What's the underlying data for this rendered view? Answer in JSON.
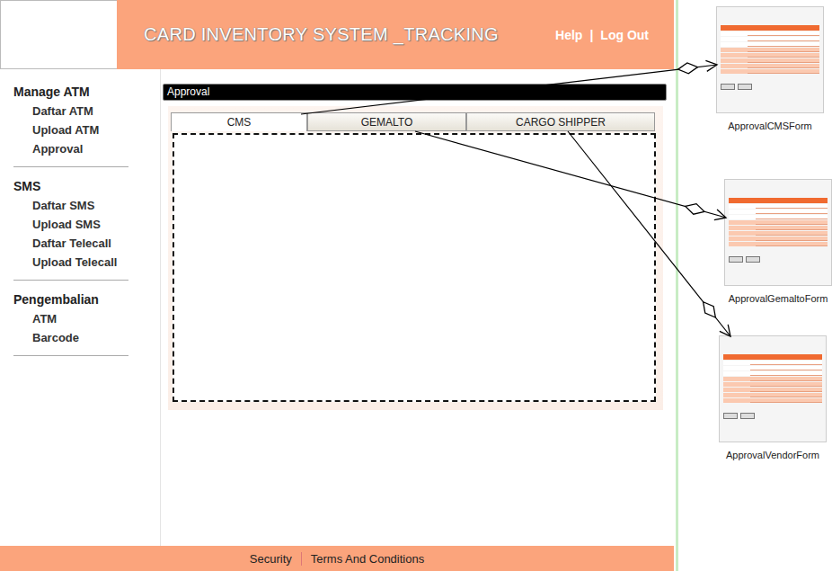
{
  "header": {
    "title": "CARD INVENTORY SYSTEM _TRACKING",
    "links": [
      "Help",
      "Log Out"
    ],
    "separator": "|"
  },
  "sidebar": {
    "groups": [
      {
        "title": "Manage ATM",
        "items": [
          "Daftar ATM",
          "Upload ATM",
          "Approval"
        ]
      },
      {
        "title": "SMS",
        "items": [
          "Daftar SMS",
          "Upload SMS",
          "Daftar Telecall",
          "Upload Telecall"
        ]
      },
      {
        "title": "Pengembalian",
        "items": [
          "ATM",
          "Barcode"
        ]
      }
    ]
  },
  "panel": {
    "title": "Approval"
  },
  "tabs": [
    {
      "label": "CMS",
      "selected": true
    },
    {
      "label": "GEMALTO",
      "selected": false
    },
    {
      "label": "CARGO SHIPPER",
      "selected": false
    }
  ],
  "footer": {
    "links": [
      "Security",
      "Terms And Conditions"
    ]
  },
  "forms": [
    {
      "name": "ApprovalCMSForm",
      "tab": "CMS"
    },
    {
      "name": "ApprovalGemaltoForm",
      "tab": "GEMALTO"
    },
    {
      "name": "ApprovalVendorForm",
      "tab": "CARGO SHIPPER"
    }
  ]
}
